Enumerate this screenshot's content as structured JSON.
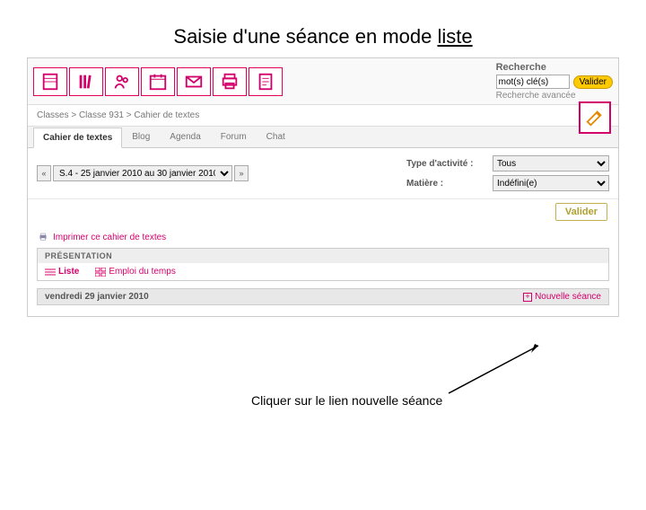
{
  "slide": {
    "title_prefix": "Saisie d'une séance en mode ",
    "title_underlined": "liste",
    "annotation": "Cliquer sur le lien nouvelle séance"
  },
  "search": {
    "label": "Recherche",
    "placeholder": "mot(s) clé(s)",
    "submit": "Valider",
    "advanced": "Recherche avancée"
  },
  "breadcrumb": "Classes > Classe 931 > Cahier de textes",
  "tabs": {
    "cahier": "Cahier de textes",
    "blog": "Blog",
    "agenda": "Agenda",
    "forum": "Forum",
    "chat": "Chat"
  },
  "date_range": "S.4 - 25 janvier 2010 au 30 janvier 2010",
  "filters": {
    "type_label": "Type d'activité :",
    "type_value": "Tous",
    "matiere_label": "Matière :",
    "matiere_value": "Indéfini(e)",
    "valider": "Valider"
  },
  "print_link": "Imprimer ce cahier de textes",
  "presentation": {
    "head": "PRÉSENTATION",
    "liste": "Liste",
    "emploi": "Emploi du temps"
  },
  "date_header": "vendredi 29 janvier 2010",
  "nouvelle_seance": "Nouvelle séance"
}
